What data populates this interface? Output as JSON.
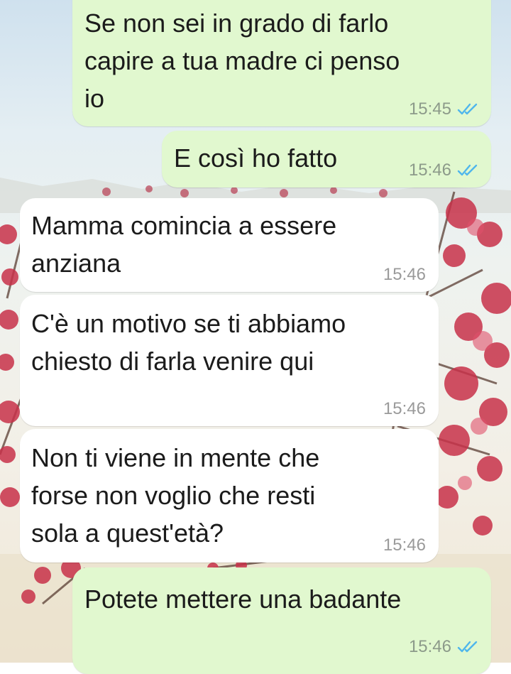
{
  "theme": {
    "outgoing_bubble": "#e1f8cf",
    "incoming_bubble": "#ffffff",
    "read_tick_color": "#4fb6ec"
  },
  "messages": [
    {
      "direction": "outgoing",
      "text": "Se non sei in grado di farlo\ncapire a tua madre ci penso\nio",
      "time": "15:45",
      "status": "read"
    },
    {
      "direction": "outgoing",
      "text": "E così ho fatto",
      "time": "15:46",
      "status": "read"
    },
    {
      "direction": "incoming",
      "text": "Mamma comincia a essere\nanziana",
      "time": "15:46"
    },
    {
      "direction": "incoming",
      "text": "C'è un motivo se ti abbiamo\nchiesto di farla venire qui",
      "time": "15:46"
    },
    {
      "direction": "incoming",
      "text": "Non ti viene in mente che\nforse non voglio che resti\nsola a quest'età?",
      "time": "15:46"
    },
    {
      "direction": "outgoing",
      "text": "Potete mettere una badante",
      "time": "15:46",
      "status": "read"
    }
  ]
}
